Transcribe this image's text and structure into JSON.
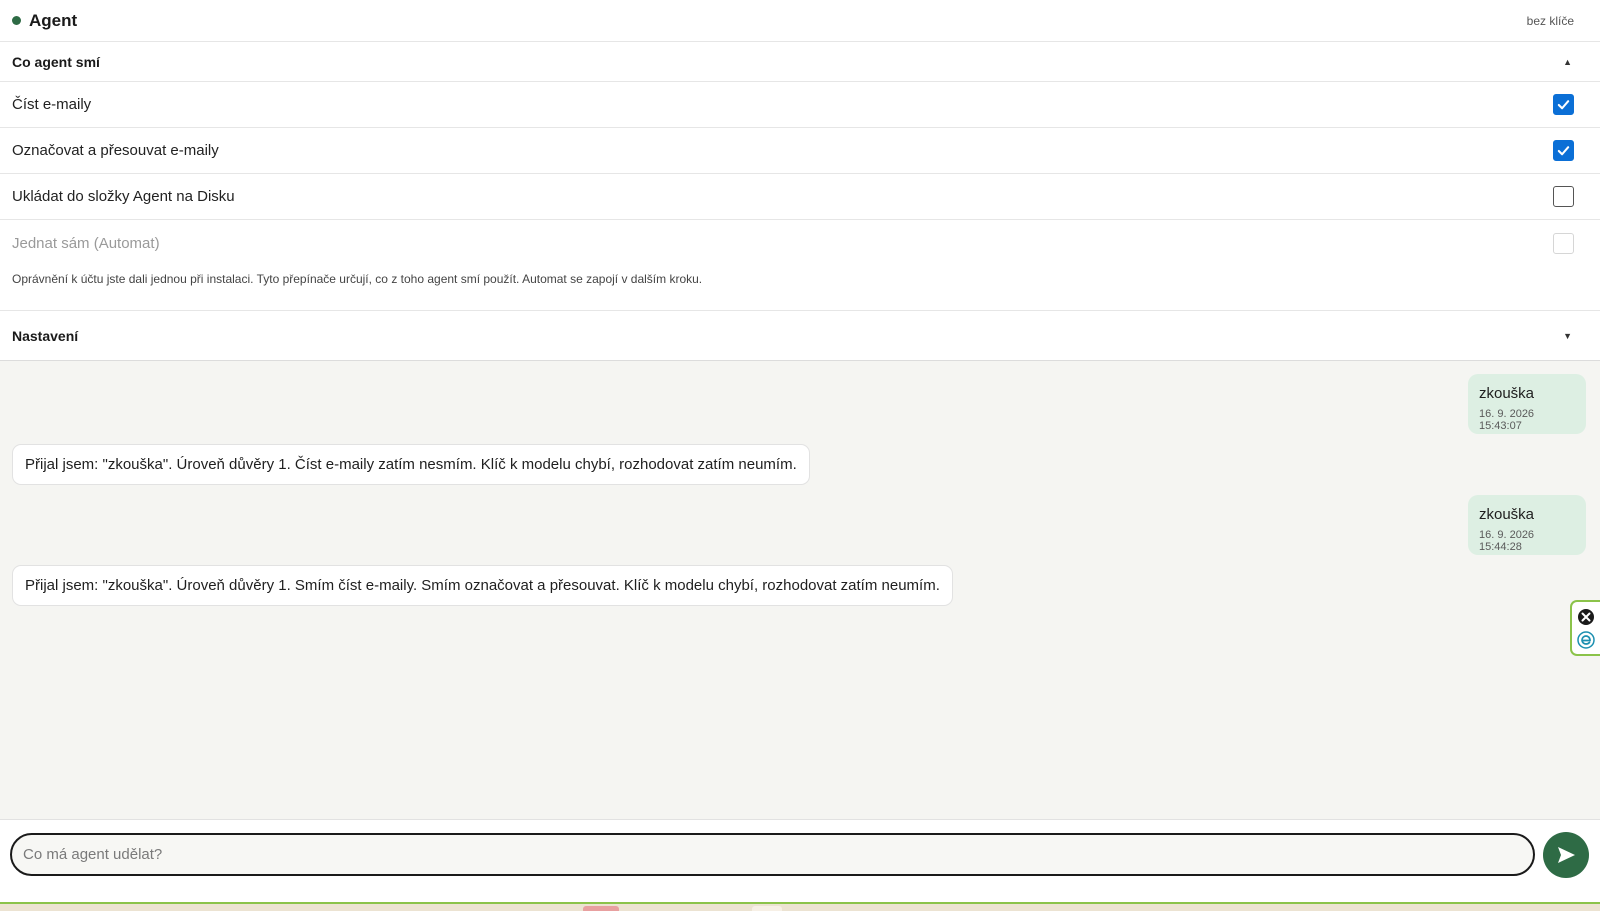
{
  "header": {
    "title": "Agent",
    "key_status": "bez klíče",
    "status_color": "#2e6b45"
  },
  "permissions": {
    "title": "Co agent smí",
    "expanded": true,
    "items": [
      {
        "label": "Číst e-maily",
        "checked": true,
        "disabled": false
      },
      {
        "label": "Označovat a přesouvat e-maily",
        "checked": true,
        "disabled": false
      },
      {
        "label": "Ukládat do složky Agent na Disku",
        "checked": false,
        "disabled": false
      },
      {
        "label": "Jednat sám (Automat)",
        "checked": false,
        "disabled": true
      }
    ],
    "note": "Oprávnění k účtu jste dali jednou při instalaci. Tyto přepínače určují, co z toho agent smí použít. Automat se zapojí v dalším kroku."
  },
  "settings": {
    "title": "Nastavení",
    "expanded": false
  },
  "messages": [
    {
      "role": "user",
      "text": "zkouška",
      "time": "16. 9. 2026 15:43:07"
    },
    {
      "role": "agent",
      "text": "Přijal jsem: \"zkouška\". Úroveň důvěry 1. Číst e-maily zatím nesmím. Klíč k modelu chybí, rozhodovat zatím neumím."
    },
    {
      "role": "user",
      "text": "zkouška",
      "time": "16. 9. 2026 15:44:28"
    },
    {
      "role": "agent",
      "text": "Přijal jsem: \"zkouška\". Úroveň důvěry 1. Smím číst e-maily. Smím označovat a přesouvat. Klíč k modelu chybí, rozhodovat zatím neumím."
    }
  ],
  "composer": {
    "placeholder": "Co má agent udělat?",
    "value": "",
    "send_icon": "send-icon",
    "accent": "#2e6b45"
  },
  "side_widget": {
    "icons": [
      "close-circle-icon",
      "e-logo-icon"
    ],
    "border_color": "#8bc34a"
  }
}
